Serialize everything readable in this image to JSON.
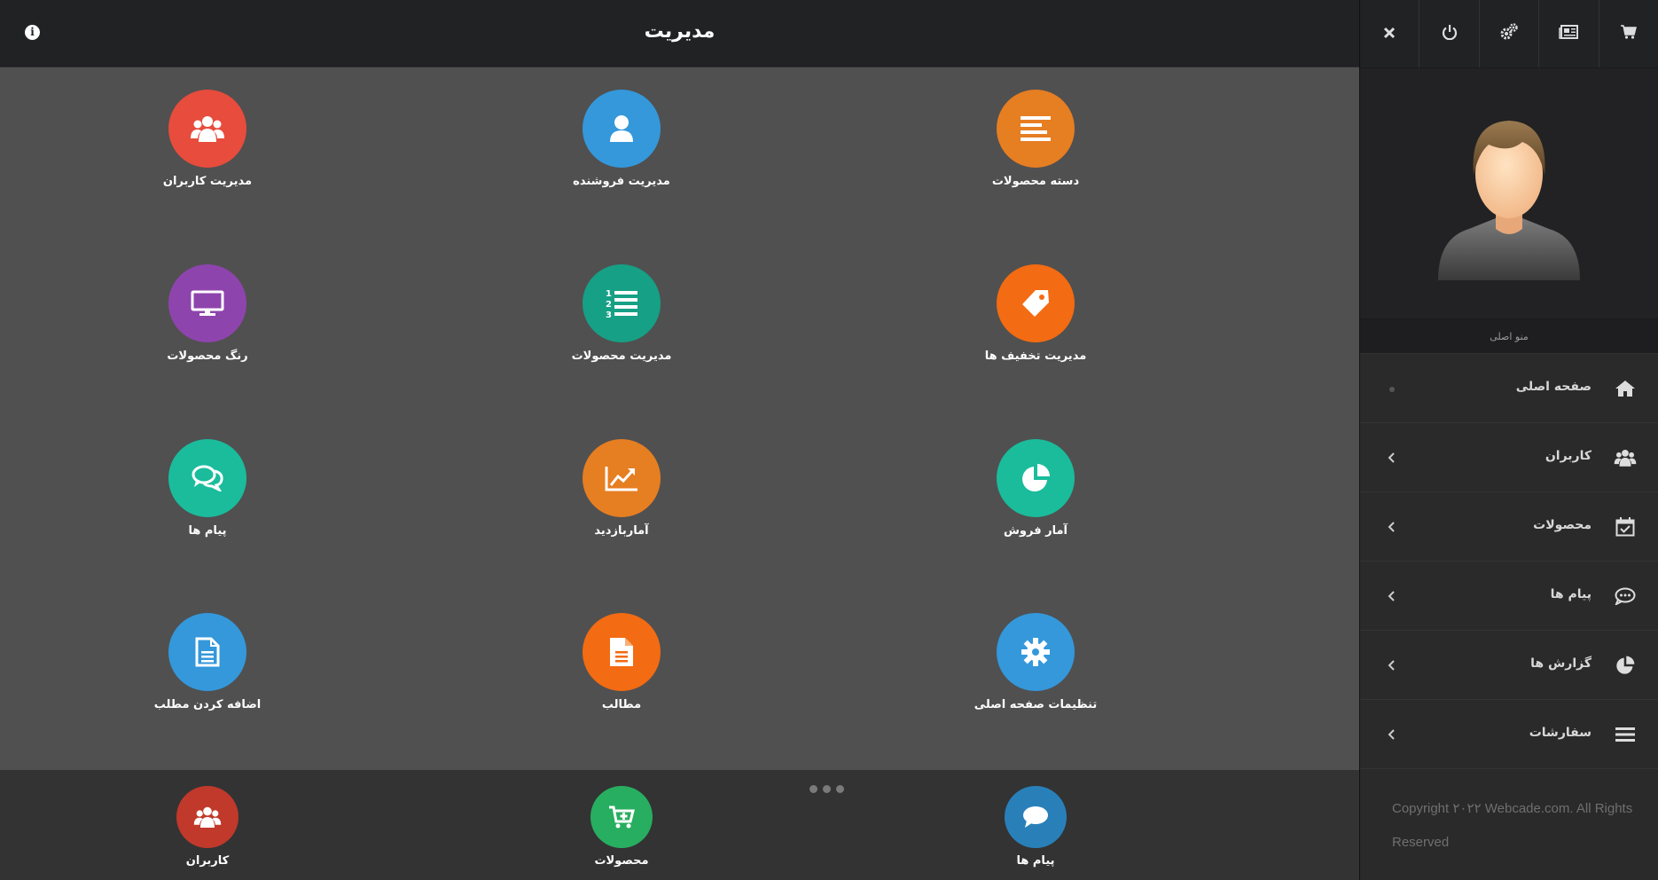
{
  "header": {
    "title": "مدیریت",
    "info_icon": "info-icon"
  },
  "tiles": [
    {
      "label": "مدیریت کاربران",
      "icon": "users-icon",
      "color": "#e74c3c"
    },
    {
      "label": "مدیریت فروشنده",
      "icon": "user-icon",
      "color": "#3498db"
    },
    {
      "label": "دسته محصولات",
      "icon": "align-icon",
      "color": "#e67e22"
    },
    {
      "label": "رنگ محصولات",
      "icon": "monitor-icon",
      "color": "#8e44ad"
    },
    {
      "label": "مدیریت محصولات",
      "icon": "numbered-list-icon",
      "color": "#16a085"
    },
    {
      "label": "مدیریت تخفیف ها",
      "icon": "tag-icon",
      "color": "#f36b12"
    },
    {
      "label": "پیام ها",
      "icon": "chat-icon",
      "color": "#1abc9c"
    },
    {
      "label": "آماربازدید",
      "icon": "line-chart-icon",
      "color": "#e67e22"
    },
    {
      "label": "آمار فروش",
      "icon": "pie-chart-icon",
      "color": "#1abc9c"
    },
    {
      "label": "اضافه کردن مطلب",
      "icon": "document-icon",
      "color": "#3498db"
    },
    {
      "label": "مطالب",
      "icon": "document-filled-icon",
      "color": "#f36b12"
    },
    {
      "label": "تنظیمات صفحه اصلی",
      "icon": "gear-icon",
      "color": "#3498db"
    }
  ],
  "dock": [
    {
      "label": "کاربران",
      "icon": "users-icon",
      "color": "#c0392b"
    },
    {
      "label": "محصولات",
      "icon": "cart-add-icon",
      "color": "#27ae60"
    },
    {
      "label": "پیام ها",
      "icon": "speech-bubble-icon",
      "color": "#2980b9"
    }
  ],
  "sidebar": {
    "top_buttons": [
      "cart-icon",
      "newspaper-icon",
      "gears-icon",
      "power-icon",
      "close-icon"
    ],
    "menu_caption": "منو اصلی",
    "menu": [
      {
        "label": "صفحه اصلی",
        "icon": "home-icon"
      },
      {
        "label": "کاربران",
        "icon": "users-icon"
      },
      {
        "label": "محصولات",
        "icon": "calendar-check-icon"
      },
      {
        "label": "پیام ها",
        "icon": "comment-dots-icon"
      },
      {
        "label": "گزارش ها",
        "icon": "pie-chart-icon"
      },
      {
        "label": "سفارشات",
        "icon": "bars-icon"
      }
    ],
    "copyright": "Copyright ۲۰۲۲ Webcade.com. All Rights Reserved"
  }
}
